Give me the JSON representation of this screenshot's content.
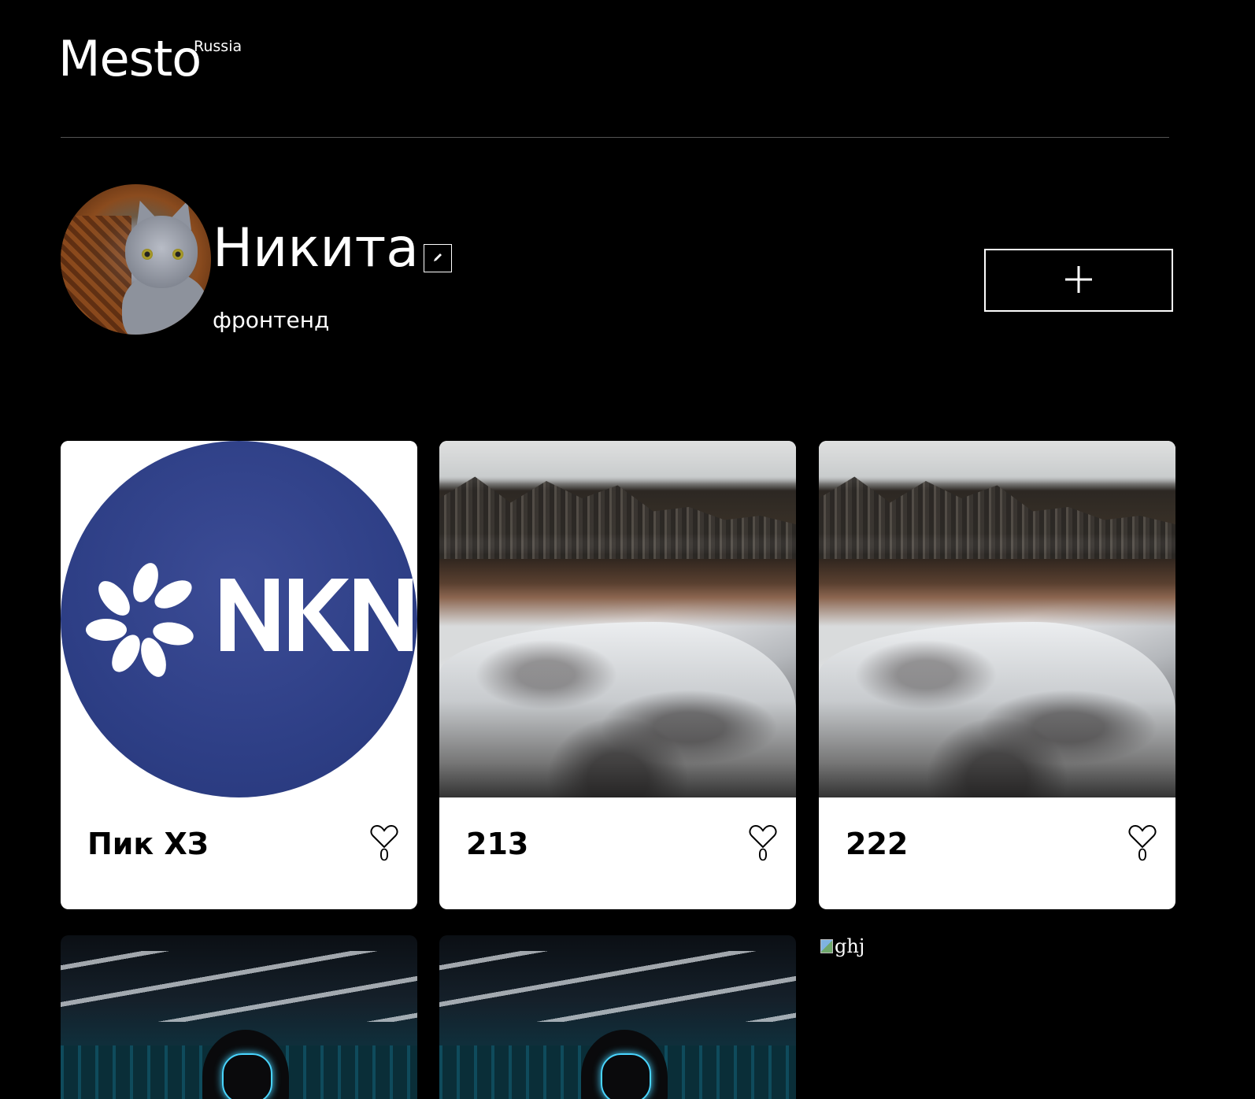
{
  "header": {
    "logo": "Mesto",
    "logo_superscript": "Russia"
  },
  "profile": {
    "name": "Никита",
    "about": "фронтенд",
    "edit_icon": "pencil-icon",
    "add_icon": "plus-icon"
  },
  "cards": [
    {
      "title": "Пик ХЗ",
      "likes": "0",
      "image": "nkn-logo"
    },
    {
      "title": "213",
      "likes": "0",
      "image": "snowy-river"
    },
    {
      "title": "222",
      "likes": "0",
      "image": "snowy-river"
    }
  ],
  "second_row": [
    {
      "image": "hooded-figure-neon-mask"
    },
    {
      "image": "hooded-figure-neon-mask"
    },
    {
      "alt": "ghj"
    }
  ],
  "colors": {
    "background": "#000000",
    "card": "#ffffff",
    "nkn_blue": "#2e3f86"
  }
}
